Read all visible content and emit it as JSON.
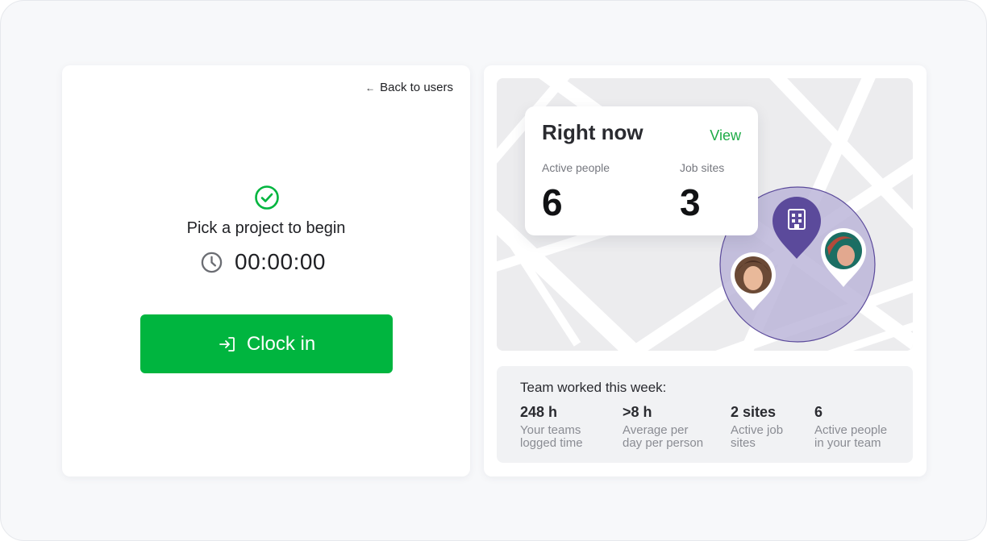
{
  "clock": {
    "back_label": "Back to users",
    "prompt": "Pick a project to begin",
    "timer": "00:00:00",
    "clock_in_label": "Clock in"
  },
  "right_now": {
    "title": "Right now",
    "view_label": "View",
    "active_people_label": "Active people",
    "active_people_value": "6",
    "job_sites_label": "Job sites",
    "job_sites_value": "3"
  },
  "team_week": {
    "heading": "Team worked this week:",
    "stats": [
      {
        "value": "248 h",
        "line1": "Your teams",
        "line2": "logged time"
      },
      {
        "value": ">8 h",
        "line1": "Average per",
        "line2": "day per person"
      },
      {
        "value": "2 sites",
        "line1": "Active job",
        "line2": "sites"
      },
      {
        "value": "6",
        "line1": "Active people",
        "line2": "in your team"
      }
    ]
  },
  "colors": {
    "accent_green": "#00b53f",
    "view_green": "#1eab47",
    "map_pin_purple": "#5b4a9b",
    "geofence_fill": "#b9b3d8"
  },
  "icons": [
    "check-circle-icon",
    "clock-icon",
    "sign-in-icon",
    "building-icon",
    "arrow-left-icon"
  ]
}
